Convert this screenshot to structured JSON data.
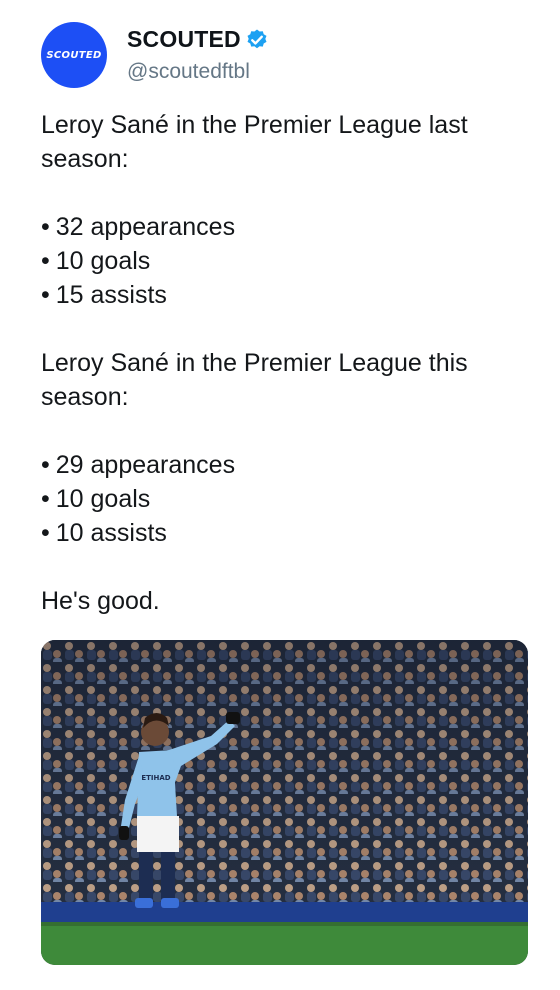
{
  "account": {
    "avatar_text": "SCOUTED",
    "display_name": "SCOUTED",
    "handle": "@scoutedftbl",
    "verified": true,
    "avatar_color": "#1d4ff5",
    "verified_color": "#1da1f2"
  },
  "tweet": {
    "intro_last": "Leroy Sané in the Premier League last season:",
    "last_season": [
      "32 appearances",
      "10 goals",
      "15 assists"
    ],
    "intro_this": "Leroy Sané in the Premier League this season:",
    "this_season": [
      "29 appearances",
      "10 goals",
      "10 assists"
    ],
    "closing": "He's good."
  },
  "media": {
    "kit_sponsor": "ETIHAD",
    "pitch_color": "#3e8a3a",
    "kit_color": "#8fc3ea"
  }
}
